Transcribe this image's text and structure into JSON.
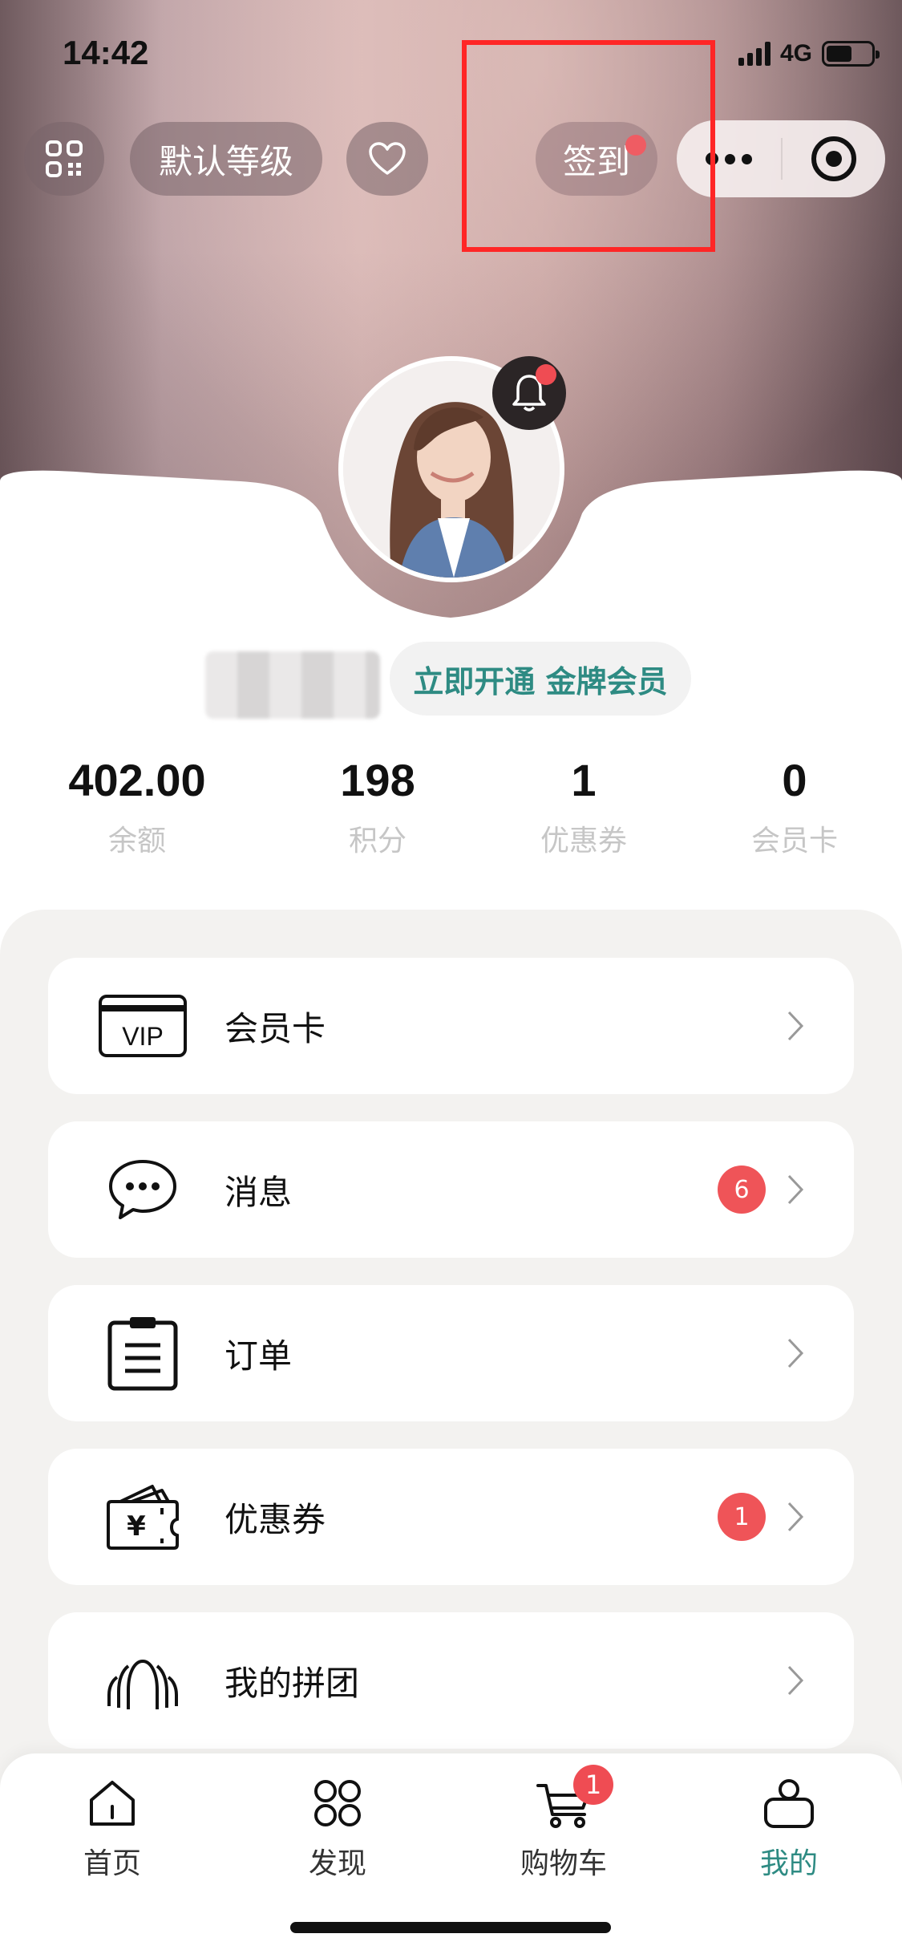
{
  "status_bar": {
    "time": "14:42",
    "network": "4G",
    "battery_level": 0.58
  },
  "header": {
    "level_label": "默认等级",
    "signin_label": "签到"
  },
  "profile": {
    "member_cta": "立即开通 金牌会员"
  },
  "stats": [
    {
      "value": "402.00",
      "label": "余额"
    },
    {
      "value": "198",
      "label": "积分"
    },
    {
      "value": "1",
      "label": "优惠券"
    },
    {
      "value": "0",
      "label": "会员卡"
    }
  ],
  "menu": [
    {
      "label": "会员卡",
      "icon": "vip-card-icon",
      "badge": ""
    },
    {
      "label": "消息",
      "icon": "chat-bubble-icon",
      "badge": "6"
    },
    {
      "label": "订单",
      "icon": "clipboard-icon",
      "badge": ""
    },
    {
      "label": "优惠券",
      "icon": "wallet-coupon-icon",
      "badge": "1"
    },
    {
      "label": "我的拼团",
      "icon": "group-icon",
      "badge": ""
    }
  ],
  "vip_icon_text": "VIP",
  "tabbar": {
    "tabs": [
      {
        "label": "首页",
        "icon": "home-icon"
      },
      {
        "label": "发现",
        "icon": "grid-four-icon"
      },
      {
        "label": "购物车",
        "icon": "cart-icon",
        "badge": "1"
      },
      {
        "label": "我的",
        "icon": "user-icon"
      }
    ],
    "active_index": 3
  },
  "colors": {
    "accent": "#2e8b83",
    "badge": "#ef5458",
    "highlight": "#ff2626"
  }
}
